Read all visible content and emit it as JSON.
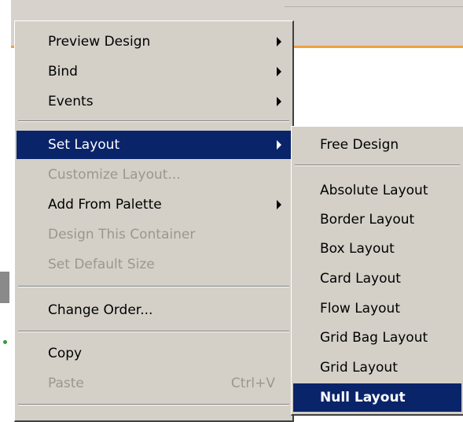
{
  "context_menu": {
    "items": [
      {
        "label": "Preview Design",
        "submenu": true,
        "disabled": false
      },
      {
        "label": "Bind",
        "submenu": true,
        "disabled": false
      },
      {
        "label": "Events",
        "submenu": true,
        "disabled": false
      },
      {
        "label": "Set Layout",
        "submenu": true,
        "disabled": false,
        "selected": true
      },
      {
        "label": "Customize Layout...",
        "submenu": false,
        "disabled": true
      },
      {
        "label": "Add From Palette",
        "submenu": true,
        "disabled": false
      },
      {
        "label": "Design This Container",
        "submenu": false,
        "disabled": true
      },
      {
        "label": "Set Default Size",
        "submenu": false,
        "disabled": true
      },
      {
        "label": "Change Order...",
        "submenu": false,
        "disabled": false
      },
      {
        "label": "Copy",
        "submenu": false,
        "disabled": false
      },
      {
        "label": "Paste",
        "submenu": false,
        "disabled": true,
        "shortcut": "Ctrl+V"
      }
    ]
  },
  "layout_submenu": {
    "items": [
      {
        "label": "Free Design"
      },
      {
        "label": "Absolute Layout"
      },
      {
        "label": "Border Layout"
      },
      {
        "label": "Box Layout"
      },
      {
        "label": "Card Layout"
      },
      {
        "label": "Flow Layout"
      },
      {
        "label": "Grid Bag Layout"
      },
      {
        "label": "Grid Layout"
      },
      {
        "label": "Null Layout",
        "selected": true
      }
    ]
  },
  "colors": {
    "menu_bg": "#d4d0c8",
    "selection": "#0a246a",
    "disabled_text": "#9b978f",
    "accent_line": "#f0a040"
  }
}
